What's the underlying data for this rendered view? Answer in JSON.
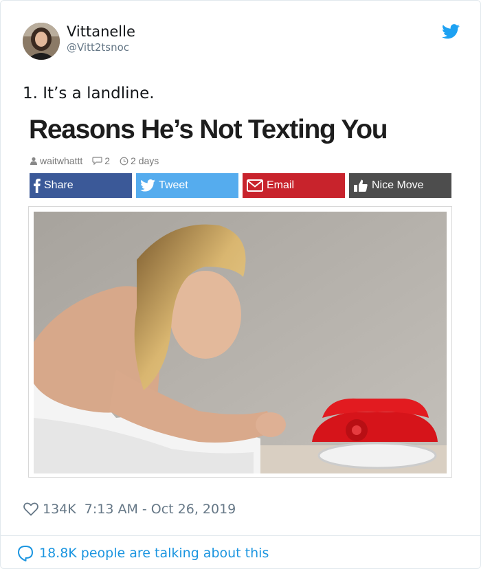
{
  "tweet": {
    "display_name": "Vittanelle",
    "handle": "@Vitt2tsnoc",
    "text": "1. It’s a landline.",
    "icons": {
      "brand": "twitter-bird-icon",
      "like": "heart-icon",
      "reply": "speech-bubble-icon"
    },
    "likes": "134K",
    "timestamp": "7:13 AM - Oct 26, 2019",
    "talking": "18.8K people are talking about this"
  },
  "article": {
    "title": "Reasons He’s Not Texting You",
    "author": "waitwhattt",
    "comments": "2",
    "age": "2 days",
    "share_buttons": {
      "facebook": "Share",
      "twitter": "Tweet",
      "email": "Email",
      "nice_move": "Nice Move"
    }
  },
  "colors": {
    "twitter_blue": "#1da1f2",
    "link_blue": "#1b95e0",
    "muted": "#657786",
    "facebook": "#3b5998",
    "tweet": "#55acee",
    "email": "#c8232c",
    "nice_move": "#4d4d4d"
  }
}
